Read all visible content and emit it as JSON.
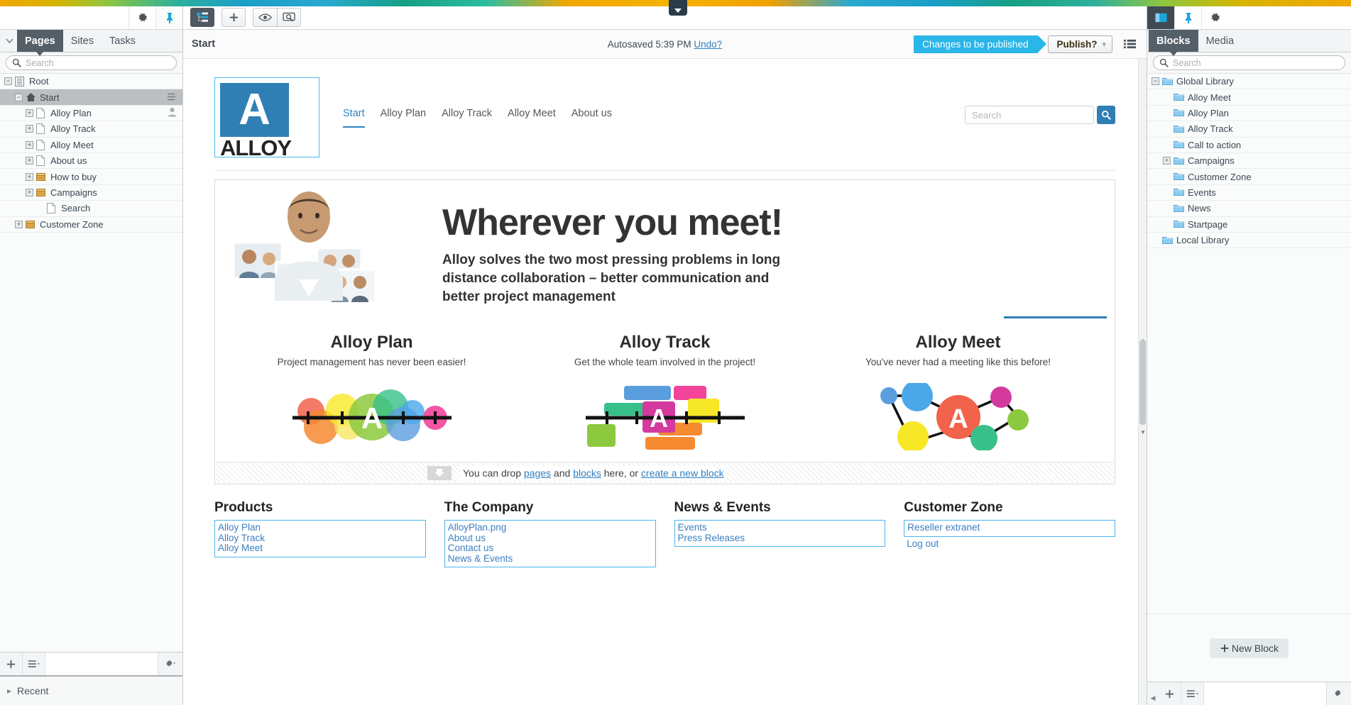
{
  "left_panel": {
    "collapse_icon": "chevron-down-icon",
    "gear_icon": "gear-icon",
    "pin_icon": "pin-icon",
    "tabs": [
      {
        "label": "Pages",
        "active": true
      },
      {
        "label": "Sites",
        "active": false
      },
      {
        "label": "Tasks",
        "active": false
      }
    ],
    "search_placeholder": "Search",
    "tree": [
      {
        "label": "Root",
        "indent": 0,
        "expander": "minus",
        "icon": "root-icon",
        "selected": false,
        "badge": ""
      },
      {
        "label": "Start",
        "indent": 1,
        "expander": "minus",
        "icon": "home-icon",
        "selected": true,
        "badge": ""
      },
      {
        "label": "Alloy Plan",
        "indent": 2,
        "expander": "plus",
        "icon": "page-icon",
        "selected": false,
        "badge": "user-icon"
      },
      {
        "label": "Alloy Track",
        "indent": 2,
        "expander": "plus",
        "icon": "page-icon",
        "selected": false,
        "badge": ""
      },
      {
        "label": "Alloy Meet",
        "indent": 2,
        "expander": "plus",
        "icon": "page-icon",
        "selected": false,
        "badge": ""
      },
      {
        "label": "About us",
        "indent": 2,
        "expander": "plus",
        "icon": "page-icon",
        "selected": false,
        "badge": ""
      },
      {
        "label": "How to buy",
        "indent": 2,
        "expander": "plus",
        "icon": "folder-page-icon",
        "selected": false,
        "badge": ""
      },
      {
        "label": "Campaigns",
        "indent": 2,
        "expander": "plus",
        "icon": "folder-page-icon",
        "selected": false,
        "badge": ""
      },
      {
        "label": "Search",
        "indent": 3,
        "expander": "none",
        "icon": "page-icon",
        "selected": false,
        "badge": ""
      },
      {
        "label": "Customer Zone",
        "indent": 1,
        "expander": "plus",
        "icon": "folder-page-icon",
        "selected": false,
        "badge": ""
      }
    ],
    "bottom": {
      "add_icon": "plus-icon",
      "menu_icon": "list-menu-icon",
      "gear_icon": "gear-icon"
    },
    "recent_label": "Recent"
  },
  "main": {
    "toolbar": {
      "structure_icon": "sitemap-icon",
      "add_icon": "plus-icon",
      "preview_icon": "eye-icon",
      "view_icon": "screen-search-icon"
    },
    "breadcrumb": "Start",
    "autosave_text": "Autosaved 5:39 PM",
    "undo_label": "Undo?",
    "publish_banner": "Changes to be published",
    "publish_button": "Publish?",
    "publish_chevron": "chevron-down-icon",
    "options_icon": "list-icon"
  },
  "site": {
    "logo_letter": "A",
    "logo_word": "ALLOY",
    "nav": [
      {
        "label": "Start",
        "active": true
      },
      {
        "label": "Alloy Plan",
        "active": false
      },
      {
        "label": "Alloy Track",
        "active": false
      },
      {
        "label": "Alloy Meet",
        "active": false
      },
      {
        "label": "About us",
        "active": false
      }
    ],
    "search_placeholder": "Search",
    "search_icon": "search-icon",
    "hero": {
      "heading": "Wherever you meet!",
      "subheading": "Alloy solves the two most pressing problems in long distance collaboration – better communication and better project management"
    },
    "products": [
      {
        "title": "Alloy Plan",
        "tagline": "Project management has never been easier!",
        "art": "timeline-dots-art"
      },
      {
        "title": "Alloy Track",
        "tagline": "Get the whole team involved in the project!",
        "art": "gantt-bars-art"
      },
      {
        "title": "Alloy Meet",
        "tagline": "You've never had a meeting like this before!",
        "art": "network-nodes-art"
      }
    ],
    "dropzone": {
      "arrow_icon": "drop-arrow-icon",
      "text_before": "You can drop ",
      "link_pages": "pages",
      "text_and": " and ",
      "link_blocks": "blocks",
      "text_after": " here, or ",
      "link_create": "create a new block"
    },
    "footer": [
      {
        "title": "Products",
        "boxed": [
          "Alloy Plan",
          "Alloy Track",
          "Alloy Meet"
        ],
        "plain": []
      },
      {
        "title": "The Company",
        "boxed": [
          "AlloyPlan.png",
          "About us",
          "Contact us",
          "News & Events"
        ],
        "plain": []
      },
      {
        "title": "News & Events",
        "boxed": [
          "Events",
          "Press Releases"
        ],
        "plain": []
      },
      {
        "title": "Customer Zone",
        "boxed": [
          "Reseller extranet"
        ],
        "plain": [
          "Log out"
        ]
      }
    ]
  },
  "right_panel": {
    "pin_icon": "pin-icon",
    "gear_icon": "gear-icon",
    "panel_icon": "panel-icon",
    "tabs": [
      {
        "label": "Blocks",
        "active": true
      },
      {
        "label": "Media",
        "active": false
      }
    ],
    "search_placeholder": "Search",
    "tree": [
      {
        "label": "Global Library",
        "indent": 0,
        "expander": "minus"
      },
      {
        "label": "Alloy Meet",
        "indent": 1,
        "expander": "none"
      },
      {
        "label": "Alloy Plan",
        "indent": 1,
        "expander": "none"
      },
      {
        "label": "Alloy Track",
        "indent": 1,
        "expander": "none"
      },
      {
        "label": "Call to action",
        "indent": 1,
        "expander": "none"
      },
      {
        "label": "Campaigns",
        "indent": 1,
        "expander": "plus"
      },
      {
        "label": "Customer Zone",
        "indent": 1,
        "expander": "none"
      },
      {
        "label": "Events",
        "indent": 1,
        "expander": "none"
      },
      {
        "label": "News",
        "indent": 1,
        "expander": "none"
      },
      {
        "label": "Startpage",
        "indent": 1,
        "expander": "none"
      },
      {
        "label": "Local Library",
        "indent": 0,
        "expander": "none"
      }
    ],
    "new_block_label": "New Block",
    "bottom": {
      "add_icon": "plus-icon",
      "menu_icon": "list-menu-icon",
      "gear_icon": "gear-icon"
    }
  },
  "colors": {
    "accent_blue": "#29b6e8",
    "brand_blue": "#2f7fb5",
    "link_blue": "#2f7fc1",
    "dark_chrome": "#4e5862"
  }
}
